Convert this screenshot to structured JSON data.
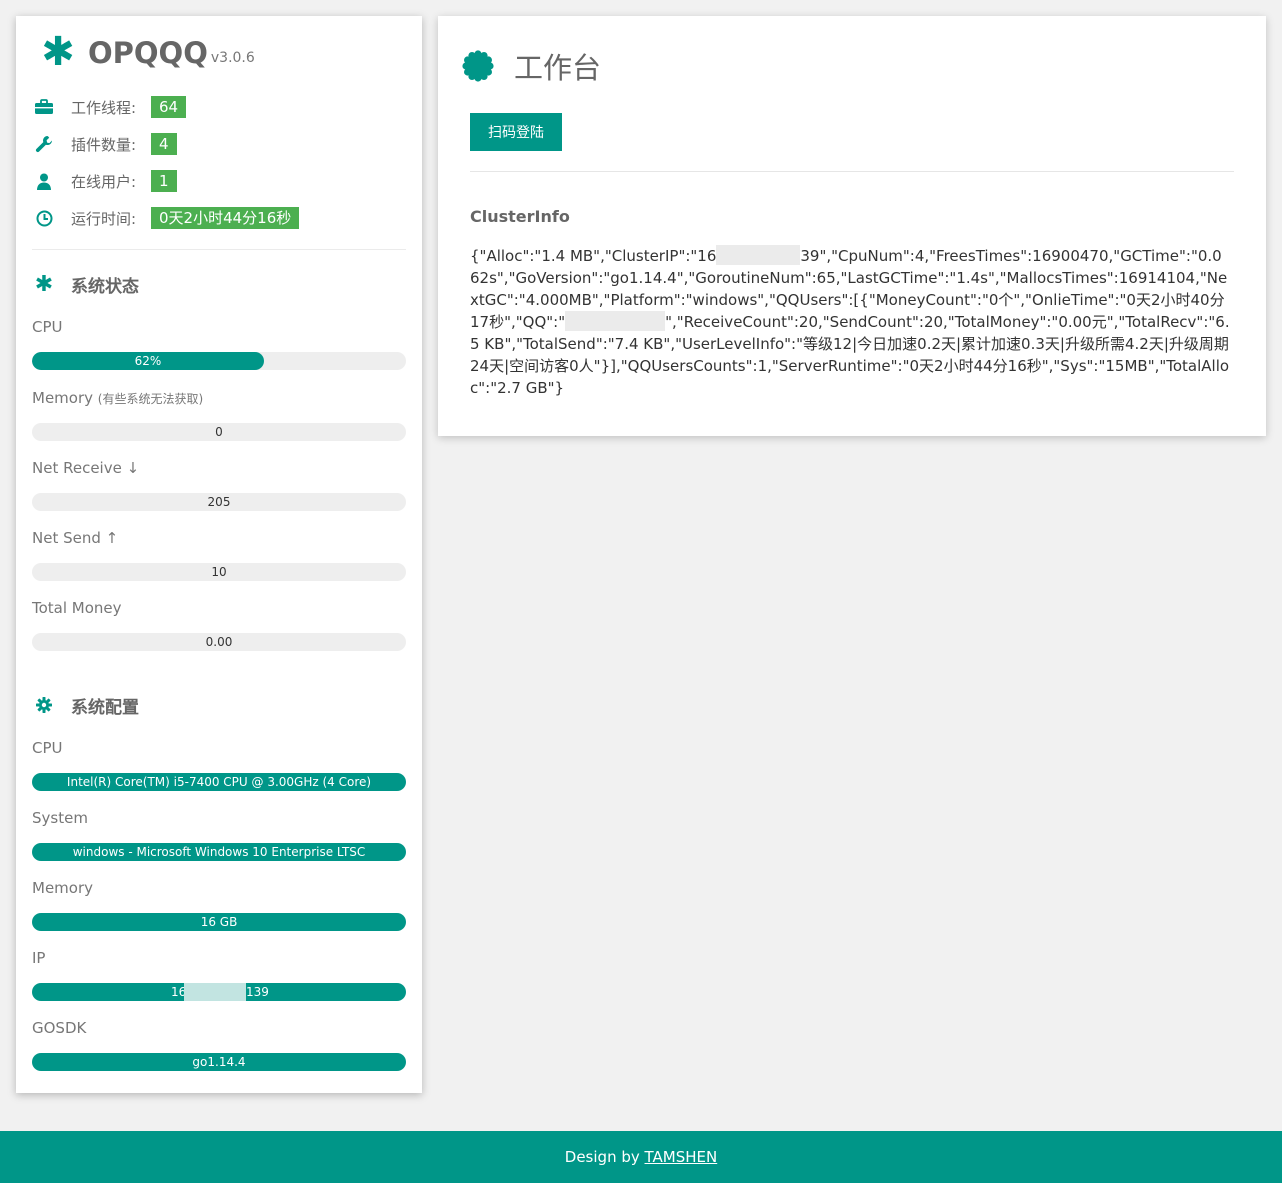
{
  "brand": {
    "name": "OPQQQ",
    "version": "v3.0.6"
  },
  "stats": [
    {
      "label": "工作线程:",
      "value": "64",
      "icon": "briefcase-icon"
    },
    {
      "label": "插件数量:",
      "value": "4",
      "icon": "wrench-icon"
    },
    {
      "label": "在线用户:",
      "value": "1",
      "icon": "user-icon"
    },
    {
      "label": "运行时间:",
      "value": "0天2小时44分16秒",
      "icon": "clock-icon"
    }
  ],
  "system_status": {
    "title": "系统状态",
    "cpu": {
      "label": "CPU",
      "value": "62%",
      "percent": 62
    },
    "memory": {
      "label": "Memory",
      "note": "(有些系统无法获取)",
      "value": "0"
    },
    "net_receive": {
      "label": "Net Receive ↓",
      "value": "205"
    },
    "net_send": {
      "label": "Net Send ↑",
      "value": "10"
    },
    "total_money": {
      "label": "Total Money",
      "value": "0.00"
    }
  },
  "system_config": {
    "title": "系统配置",
    "cpu": {
      "label": "CPU",
      "value": "Intel(R) Core(TM) i5-7400 CPU @ 3.00GHz (4 Core)"
    },
    "system": {
      "label": "System",
      "value": "windows - Microsoft Windows 10 Enterprise LTSC"
    },
    "memory": {
      "label": "Memory",
      "value": "16 GB"
    },
    "ip": {
      "label": "IP",
      "value_start": "16",
      "value_end": "139"
    },
    "gosdk": {
      "label": "GOSDK",
      "value": "go1.14.4"
    }
  },
  "main": {
    "title": "工作台",
    "scan_button": "扫码登陆",
    "cluster_title": "ClusterInfo",
    "cluster_part1": "{\"Alloc\":\"1.4 MB\",\"ClusterIP\":\"16",
    "cluster_part2": "39\",\"CpuNum\":4,\"FreesTimes\":16900470,\"GCTime\":\"0.062s\",\"GoVersion\":\"go1.14.4\",\"GoroutineNum\":65,\"LastGCTime\":\"1.4s\",\"MallocsTimes\":16914104,\"NextGC\":\"4.000MB\",\"Platform\":\"windows\",\"QQUsers\":[{\"MoneyCount\":\"0个\",\"OnlieTime\":\"0天2小时40分17秒\",\"QQ\":\"",
    "cluster_part3": "\",\"ReceiveCount\":20,\"SendCount\":20,\"TotalMoney\":\"0.00元\",\"TotalRecv\":\"6.5 KB\",\"TotalSend\":\"7.4 KB\",\"UserLevelInfo\":\"等级12|今日加速0.2天|累计加速0.3天|升级所需4.2天|升级周期24天|空间访客0人\"}],\"QQUsersCounts\":1,\"ServerRuntime\":\"0天2小时44分16秒\",\"Sys\":\"15MB\",\"TotalAlloc\":\"2.7 GB\"}"
  },
  "footer": {
    "prefix": "Design by ",
    "link": "TAMSHEN"
  },
  "colors": {
    "accent": "#009688",
    "badge": "#4caf50",
    "background": "#f1f1f1"
  }
}
